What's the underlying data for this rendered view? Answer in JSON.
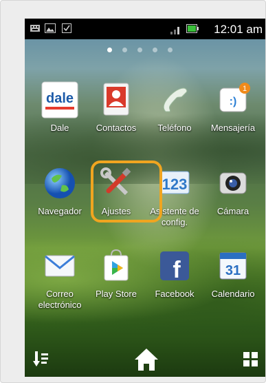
{
  "status_bar": {
    "time": "12:01 am",
    "left_icons": [
      "keyboard-icon",
      "image-icon",
      "checkbox-icon"
    ],
    "right_icons": [
      "signal-icon",
      "battery-icon"
    ]
  },
  "page_indicator": {
    "count": 5,
    "active": 0
  },
  "apps": [
    {
      "label": "Dale",
      "icon": "dale-icon"
    },
    {
      "label": "Contactos",
      "icon": "contacts-icon"
    },
    {
      "label": "Teléfono",
      "icon": "phone-icon"
    },
    {
      "label": "Mensajería",
      "icon": "messaging-icon",
      "badge": "1"
    },
    {
      "label": "Navegador",
      "icon": "browser-globe-icon"
    },
    {
      "label": "Ajustes",
      "icon": "settings-tools-icon"
    },
    {
      "label": "Asistente de\nconfig.",
      "icon": "setup-wizard-icon",
      "icon_text": "123"
    },
    {
      "label": "Cámara",
      "icon": "camera-icon"
    },
    {
      "label": "Correo\nelectrónico",
      "icon": "email-icon"
    },
    {
      "label": "Play Store",
      "icon": "play-store-icon"
    },
    {
      "label": "Facebook",
      "icon": "facebook-icon",
      "icon_text": "f"
    },
    {
      "label": "Calendario",
      "icon": "calendar-icon",
      "icon_text": "31"
    }
  ],
  "dale_logo_text": "dale",
  "highlight_color": "#f0a520",
  "dock": [
    "sort-icon",
    "home-icon",
    "apps-grid-icon"
  ]
}
